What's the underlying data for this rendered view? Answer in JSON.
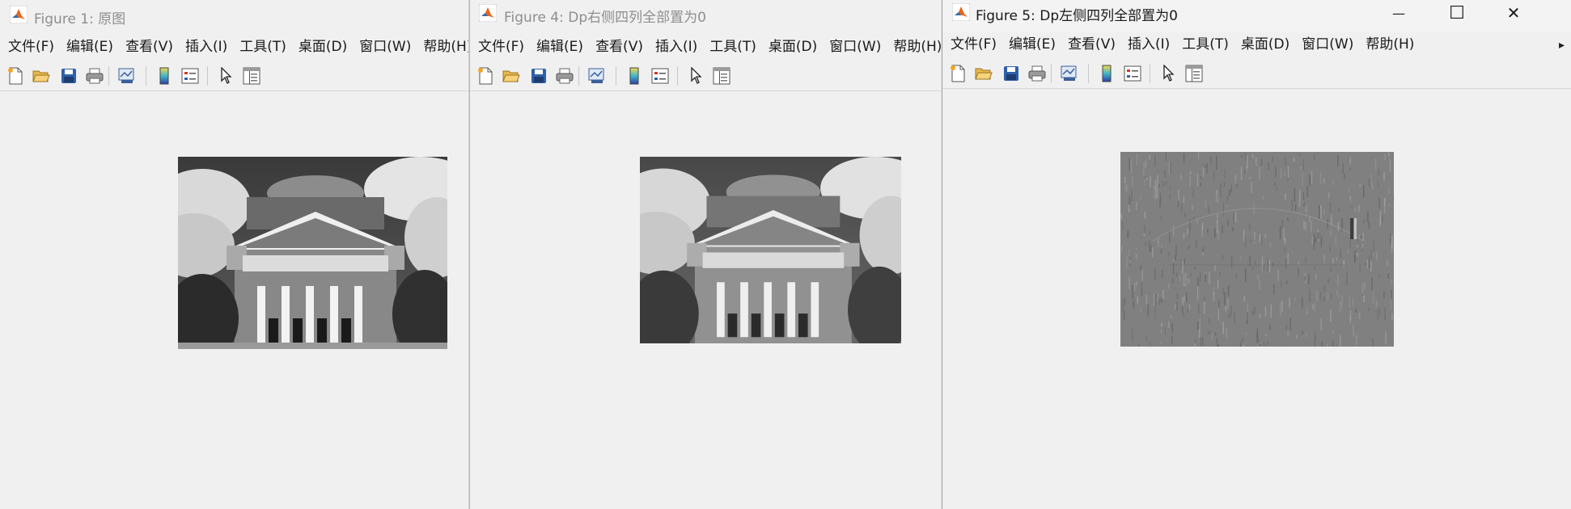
{
  "windows": [
    {
      "title": "Figure 1: 原图",
      "menus": [
        "文件(F)",
        "编辑(E)",
        "查看(V)",
        "插入(I)",
        "工具(T)",
        "桌面(D)",
        "窗口(W)",
        "帮助(H)"
      ]
    },
    {
      "title": "Figure 4: Dp右侧四列全部置为0",
      "menus": [
        "文件(F)",
        "编辑(E)",
        "查看(V)",
        "插入(I)",
        "工具(T)",
        "桌面(D)",
        "窗口(W)",
        "帮助(H)"
      ]
    },
    {
      "title": "Figure 5: Dp左侧四列全部置为0",
      "menus": [
        "文件(F)",
        "编辑(E)",
        "查看(V)",
        "插入(I)",
        "工具(T)",
        "桌面(D)",
        "窗口(W)",
        "帮助(H)"
      ],
      "controls": {
        "minimize": "—",
        "maximize": "☐",
        "close": "✕"
      },
      "overflow_arrow": "▸"
    }
  ],
  "toolbar_icons": [
    "new-figure-icon",
    "open-file-icon",
    "save-icon",
    "print-icon",
    "link-plot-icon",
    "colorbar-icon",
    "legend-icon",
    "pointer-icon",
    "property-inspector-icon"
  ],
  "colors": {
    "window_bg": "#f0f0f0",
    "title_inactive": "#8e8e8e",
    "title_active": "#1a1a1a"
  }
}
